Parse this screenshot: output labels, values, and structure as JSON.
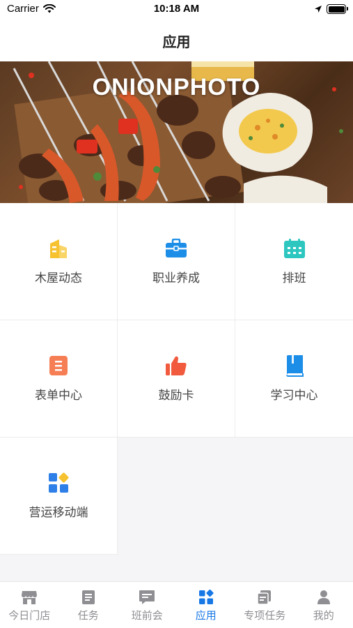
{
  "status_bar": {
    "carrier": "Carrier",
    "time": "10:18 AM"
  },
  "nav": {
    "title": "应用"
  },
  "banner": {
    "watermark": "ONIONPHOTO"
  },
  "apps": [
    {
      "label": "木屋动态",
      "icon": "building-icon",
      "color": "#f7c230"
    },
    {
      "label": "职业养成",
      "icon": "briefcase-icon",
      "color": "#1c8ee8"
    },
    {
      "label": "排班",
      "icon": "calendar-icon",
      "color": "#2dc7c0"
    },
    {
      "label": "表单中心",
      "icon": "form-icon",
      "color": "#f67e55"
    },
    {
      "label": "鼓励卡",
      "icon": "thumbs-up-icon",
      "color": "#f15a3c"
    },
    {
      "label": "学习中心",
      "icon": "book-icon",
      "color": "#1c8ee8"
    },
    {
      "label": "营运移动端",
      "icon": "apps-grid-icon",
      "color": "#2f7fe8"
    }
  ],
  "tabs": [
    {
      "label": "今日门店",
      "icon": "store-icon",
      "active": false
    },
    {
      "label": "任务",
      "icon": "task-icon",
      "active": false
    },
    {
      "label": "班前会",
      "icon": "meeting-icon",
      "active": false
    },
    {
      "label": "应用",
      "icon": "apps-icon",
      "active": true
    },
    {
      "label": "专项任务",
      "icon": "special-task-icon",
      "active": false
    },
    {
      "label": "我的",
      "icon": "profile-icon",
      "active": false
    }
  ],
  "colors": {
    "active_tab": "#1677e5",
    "inactive_tab": "#8e8e93"
  }
}
